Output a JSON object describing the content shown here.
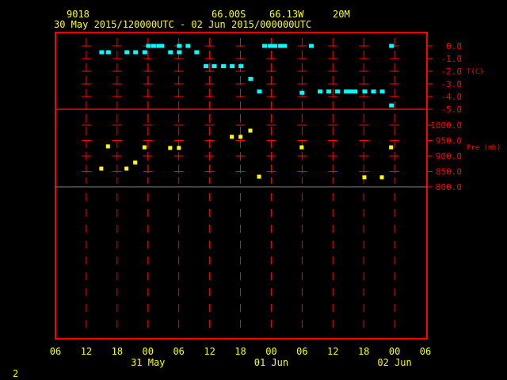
{
  "header": {
    "station": "9018",
    "lat": "66.00S",
    "lon": "66.13W",
    "elev": "20M",
    "period": "30 May 2015/120000UTC - 02 Jun 2015/000000UTC"
  },
  "footer": {
    "page": "2"
  },
  "colors": {
    "frame": "#ff0000",
    "temp": "#00ffff",
    "pres": "#ffff00",
    "text": "#ffff00"
  },
  "chart_data": [
    {
      "type": "scatter",
      "title": "T(C)",
      "ylabel": "T(C)",
      "x_units": "hours since 30 May 2015 06 UTC",
      "xlim": [
        0,
        72
      ],
      "ylim": [
        -5,
        0
      ],
      "yticks": [
        0,
        -1,
        -2,
        -3,
        -4,
        -5
      ],
      "ytick_labels": [
        "0.0",
        "-1.0",
        "-2.0",
        "-3.0",
        "-4.0",
        "-5.0"
      ],
      "x": [
        9,
        10.3,
        13.9,
        15.6,
        17.4,
        18.1,
        19.1,
        20.1,
        20.7,
        22.4,
        24.1,
        24.1,
        25.8,
        27.5,
        29.3,
        30.9,
        32.7,
        34.4,
        36.1,
        38,
        39.7,
        40.7,
        41.8,
        42.7,
        43.8,
        44.6,
        48,
        49.8,
        51.5,
        53.2,
        54.9,
        56.6,
        57.4,
        58.3,
        60.2,
        61.9,
        63.6,
        65.4,
        65.4
      ],
      "y": [
        -0.5,
        -0.5,
        -0.5,
        -0.5,
        -0.5,
        0,
        0,
        0,
        0,
        -0.5,
        -0.5,
        0,
        0,
        -0.5,
        -1.6,
        -1.6,
        -1.6,
        -1.6,
        -1.6,
        -2.6,
        -3.6,
        0,
        0,
        0,
        0,
        0,
        -3.7,
        0,
        -3.6,
        -3.6,
        -3.6,
        -3.6,
        -3.6,
        -3.6,
        -3.6,
        -3.6,
        -3.6,
        0,
        -4.7
      ]
    },
    {
      "type": "scatter",
      "title": "Pre (mb)",
      "ylabel": "Pre (mb)",
      "x_units": "hours since 30 May 2015 06 UTC",
      "xlim": [
        0,
        72
      ],
      "ylim": [
        800,
        1000
      ],
      "yticks": [
        1000,
        950,
        900,
        850,
        800
      ],
      "ytick_labels": [
        "1000.0",
        "950.0",
        "900.0",
        "850.0",
        "800.0"
      ],
      "x": [
        9,
        10.3,
        13.9,
        15.6,
        17.4,
        22.4,
        24.1,
        34.4,
        36.1,
        38,
        39.7,
        48,
        60.2,
        63.6,
        65.4
      ],
      "y": [
        859,
        931,
        859,
        879,
        928,
        926,
        926,
        962,
        962,
        982,
        833,
        928,
        831,
        831,
        928
      ]
    }
  ],
  "xaxis": {
    "tick_labels": [
      "06",
      "12",
      "18",
      "00",
      "06",
      "12",
      "18",
      "00",
      "06",
      "12",
      "18",
      "00",
      "06"
    ],
    "day_labels": [
      {
        "label": "31 May",
        "tick": 3
      },
      {
        "label": "01 Jun",
        "tick": 7
      },
      {
        "label": "02 Jun",
        "tick": 11
      }
    ]
  }
}
